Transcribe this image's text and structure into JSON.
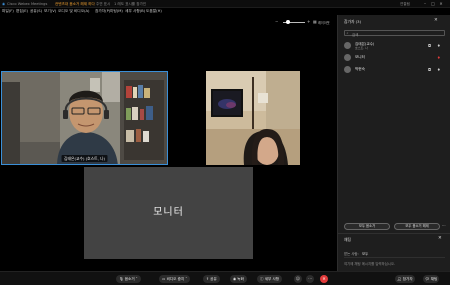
{
  "title_bar": {
    "app_name": "Cisco Webex Meetings",
    "meeting_name": "컨텐츠대 음소거 해제 하다",
    "extra": "주연 표시",
    "notice": "1 래도 표시를 참가인",
    "right_label": "연결됨"
  },
  "menu": {
    "items": [
      "파일(F)",
      "편집(E)",
      "공유(S)",
      "보기(V)",
      "오디오 및 비디오(A)",
      "참가자(P)",
      "미팅(M)",
      "세부 사항(B)",
      "도움말(H)"
    ]
  },
  "stage": {
    "tile1_name": "김태은(교수) (호스트, 나)",
    "tile2_name": "",
    "tile3_label": "모니터",
    "layout_label": "레이아웃"
  },
  "panel": {
    "title": "참가자 (3)",
    "search_placeholder": "검색",
    "participants": [
      {
        "name": "김태은(교수)",
        "role": "호스트, 나"
      },
      {
        "name": "모니터",
        "role": ""
      },
      {
        "name": "박현숙",
        "role": ""
      }
    ],
    "mute_all": "모두 음소거",
    "unmute_all": "모두 음소거 해제",
    "chat_title": "채팅",
    "chat_to_label": "받는 사람:",
    "chat_to_value": "모두",
    "chat_placeholder": "여기에 채팅 메시지를 입력하십시오."
  },
  "toolbar": {
    "mute": "음소거",
    "video": "비디오 중지",
    "share": "공유",
    "record": "녹화",
    "details": "세부 사항",
    "participants": "참가자",
    "chat": "채팅"
  },
  "colors": {
    "accent": "#3a8fd8",
    "end": "#e23b3b",
    "title_orange": "#f0a030"
  }
}
